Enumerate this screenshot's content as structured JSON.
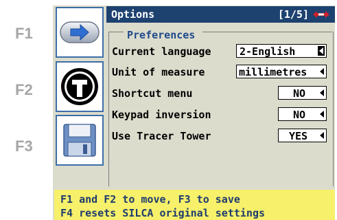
{
  "function_keys": [
    "F1",
    "F2",
    "F3"
  ],
  "side_buttons": [
    {
      "icon": "arrow-right-icon"
    },
    {
      "icon": "tracer-t-icon"
    },
    {
      "icon": "save-disk-icon"
    }
  ],
  "titlebar": {
    "title": "Options",
    "page": "[1/5]",
    "logo": "silca-logo-icon"
  },
  "section": {
    "title": "Preferences"
  },
  "settings": [
    {
      "label": "Current language",
      "value": "2-English",
      "control": "selected"
    },
    {
      "label": "Unit of measure",
      "value": "millimetres",
      "control": "arrow"
    },
    {
      "label": "Shortcut menu",
      "value": "NO",
      "control": "arrow"
    },
    {
      "label": "Keypad inversion",
      "value": "NO",
      "control": "arrow"
    },
    {
      "label": "Use Tracer Tower",
      "value": "YES",
      "control": "arrow"
    }
  ],
  "footer": {
    "line1": "F1 and F2 to move, F3 to save",
    "line2": "F4 resets SILCA original settings"
  },
  "colors": {
    "titlebar": "#1e4270",
    "footer_bg": "#f7f06a",
    "panel_bg": "#dcdccd",
    "accent": "#3c6ea8",
    "logo_red": "#d0202a"
  }
}
